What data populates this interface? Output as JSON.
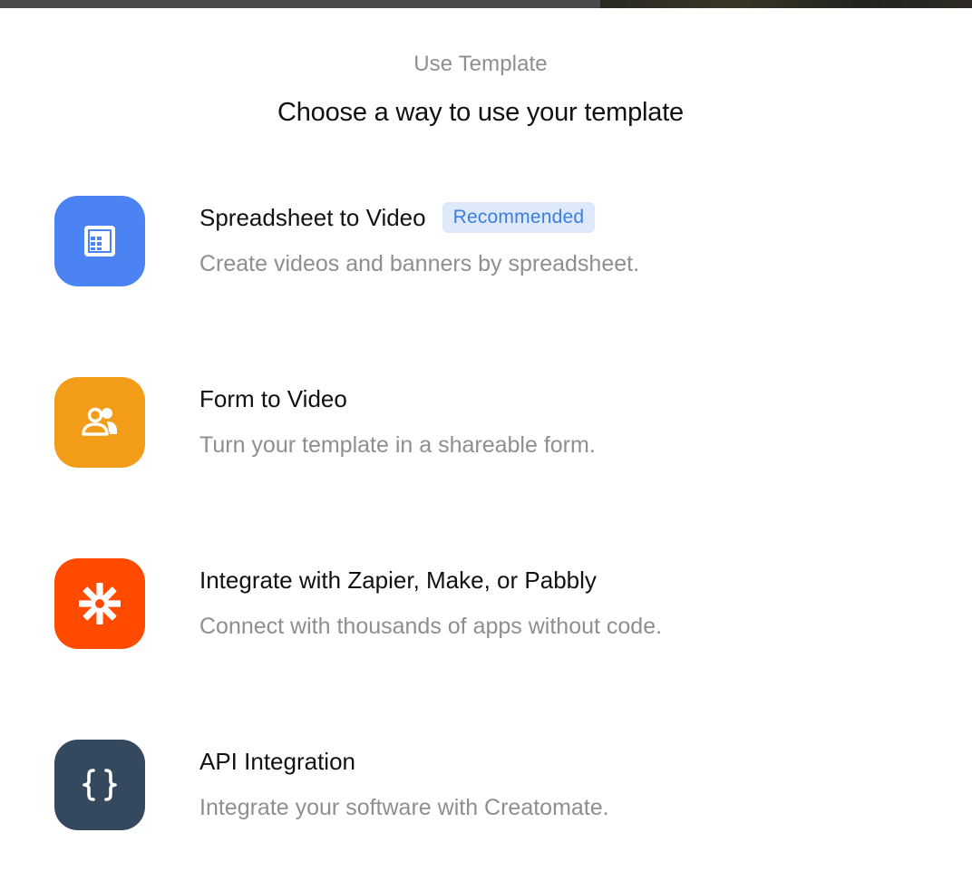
{
  "header": {
    "subtitle": "Use Template",
    "title": "Choose a way to use your template"
  },
  "options": [
    {
      "title": "Spreadsheet to Video",
      "badge": "Recommended",
      "description": "Create videos and banners by spreadsheet.",
      "icon": "spreadsheet-icon",
      "color": "#4b84f2"
    },
    {
      "title": "Form to Video",
      "description": "Turn your template in a shareable form.",
      "icon": "users-icon",
      "color": "#f39c18"
    },
    {
      "title": "Integrate with Zapier, Make, or Pabbly",
      "description": "Connect with thousands of apps without code.",
      "icon": "zapier-asterisk-icon",
      "color": "#ff4a00"
    },
    {
      "title": "API Integration",
      "description": "Integrate your software with Creatomate.",
      "icon": "curly-braces-icon",
      "color": "#34495e"
    }
  ],
  "colors": {
    "badge_background": "#deeafb",
    "badge_text": "#3b7de0",
    "muted_text": "#8e8e93"
  }
}
